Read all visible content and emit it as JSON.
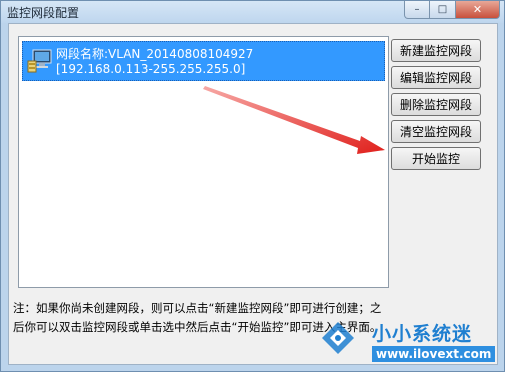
{
  "window": {
    "title": "监控网段配置",
    "controls": {
      "minimize": "–",
      "maximize": "□",
      "close": "✕"
    }
  },
  "segment_list": {
    "items": [
      {
        "name_line": "网段名称:VLAN_20140808104927",
        "range_line": "[192.168.0.113-255.255.255.0]",
        "selected": true,
        "icon": "network-computer-icon"
      }
    ]
  },
  "buttons": {
    "new_segment": "新建监控网段",
    "edit_segment": "编辑监控网段",
    "delete_segment": "删除监控网段",
    "clear_segment": "清空监控网段",
    "start_monitor": "开始监控"
  },
  "note": {
    "text": "注：如果你尚未创建网段，则可以点击“新建监控网段”即可进行创建；之后你可以双击监控网段或单击选中然后点击“开始监控”即可进入主界面。"
  },
  "annotation": {
    "arrow_color": "#e0201c",
    "icon": "red-arrow-icon"
  },
  "watermark": {
    "cn": "小小系统迷",
    "url": "www.ilovext.com",
    "color": "#1f7fd0"
  }
}
